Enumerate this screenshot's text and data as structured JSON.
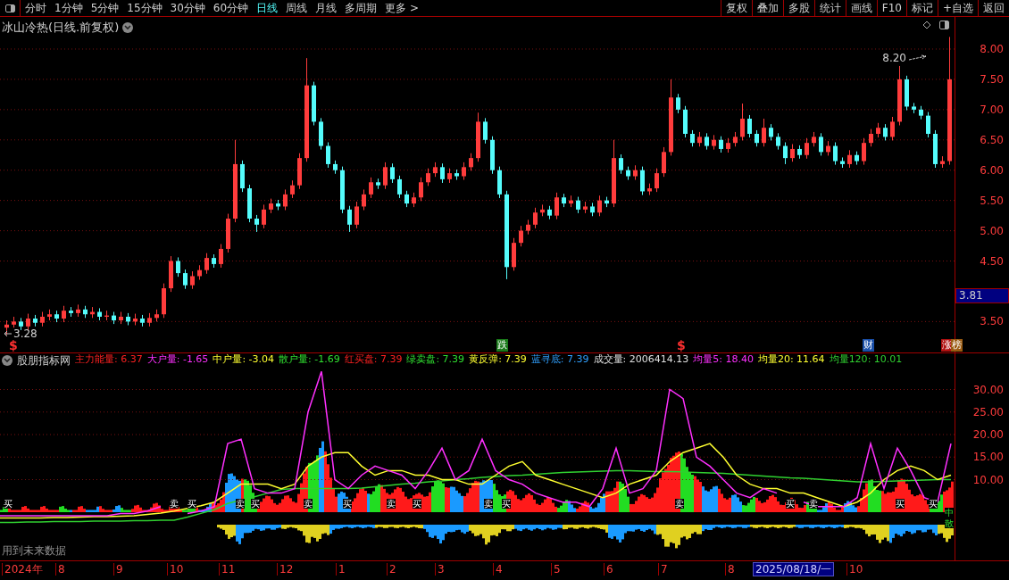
{
  "toolbar": {
    "periods": [
      {
        "label": "分时",
        "selected": false
      },
      {
        "label": "1分钟",
        "selected": false
      },
      {
        "label": "5分钟",
        "selected": false
      },
      {
        "label": "15分钟",
        "selected": false
      },
      {
        "label": "30分钟",
        "selected": false
      },
      {
        "label": "60分钟",
        "selected": false
      },
      {
        "label": "日线",
        "selected": true
      },
      {
        "label": "周线",
        "selected": false
      },
      {
        "label": "月线",
        "selected": false
      },
      {
        "label": "多周期",
        "selected": false
      },
      {
        "label": "更多 >",
        "selected": false
      }
    ],
    "buttons": [
      "复权",
      "叠加",
      "多股",
      "统计",
      "画线",
      "F10",
      "标记",
      "+自选",
      "返回"
    ]
  },
  "main_chart": {
    "title": "冰山冷热(日线.前复权)",
    "high_label": "8.20",
    "low_label": "3.28",
    "chart_data": {
      "type": "candlestick",
      "ylim": [
        2.99,
        8.53
      ],
      "grid": true,
      "yticks": [
        {
          "value": 8,
          "label": "8.00"
        },
        {
          "value": 7.5,
          "label": "7.50"
        },
        {
          "value": 7,
          "label": "7.00"
        },
        {
          "value": 6.5,
          "label": "6.50"
        },
        {
          "value": 6,
          "label": "6.00"
        },
        {
          "value": 5.5,
          "label": "5.50"
        },
        {
          "value": 5,
          "label": "5.00"
        },
        {
          "value": 4.5,
          "label": "4.50"
        },
        {
          "value": 3.5,
          "label": "3.50"
        }
      ],
      "ohlc": [
        [
          3.4,
          3.52,
          3.28,
          3.45
        ],
        [
          3.45,
          3.58,
          3.4,
          3.5
        ],
        [
          3.5,
          3.56,
          3.36,
          3.42
        ],
        [
          3.42,
          3.63,
          3.36,
          3.55
        ],
        [
          3.55,
          3.61,
          3.42,
          3.48
        ],
        [
          3.48,
          3.66,
          3.42,
          3.58
        ],
        [
          3.58,
          3.7,
          3.52,
          3.62
        ],
        [
          3.62,
          3.68,
          3.49,
          3.55
        ],
        [
          3.55,
          3.76,
          3.49,
          3.68
        ],
        [
          3.68,
          3.74,
          3.58,
          3.64
        ],
        [
          3.64,
          3.78,
          3.58,
          3.7
        ],
        [
          3.7,
          3.76,
          3.56,
          3.62
        ],
        [
          3.62,
          3.74,
          3.56,
          3.66
        ],
        [
          3.66,
          3.72,
          3.52,
          3.58
        ],
        [
          3.58,
          3.68,
          3.52,
          3.6
        ],
        [
          3.6,
          3.66,
          3.46,
          3.52
        ],
        [
          3.52,
          3.66,
          3.46,
          3.58
        ],
        [
          3.58,
          3.64,
          3.44,
          3.5
        ],
        [
          3.5,
          3.63,
          3.44,
          3.55
        ],
        [
          3.55,
          3.61,
          3.42,
          3.48
        ],
        [
          3.48,
          3.64,
          3.42,
          3.56
        ],
        [
          3.56,
          3.7,
          3.5,
          3.62
        ],
        [
          3.62,
          4.13,
          3.56,
          4.05
        ],
        [
          4.05,
          4.58,
          3.99,
          4.5
        ],
        [
          4.5,
          4.56,
          4.24,
          4.3
        ],
        [
          4.3,
          4.36,
          4.04,
          4.1
        ],
        [
          4.1,
          4.33,
          4.04,
          4.25
        ],
        [
          4.25,
          4.43,
          4.19,
          4.35
        ],
        [
          4.35,
          4.63,
          4.29,
          4.55
        ],
        [
          4.55,
          4.61,
          4.39,
          4.45
        ],
        [
          4.45,
          4.78,
          4.39,
          4.7
        ],
        [
          4.7,
          5.28,
          4.64,
          5.2
        ],
        [
          5.2,
          6.5,
          5.14,
          6.1
        ],
        [
          6.1,
          6.16,
          5.64,
          5.7
        ],
        [
          5.7,
          5.76,
          5.14,
          5.2
        ],
        [
          5.2,
          5.26,
          4.98,
          5.1
        ],
        [
          5.1,
          5.43,
          5.04,
          5.35
        ],
        [
          5.35,
          5.53,
          5.29,
          5.45
        ],
        [
          5.45,
          5.51,
          5.34,
          5.4
        ],
        [
          5.4,
          5.68,
          5.34,
          5.6
        ],
        [
          5.6,
          5.83,
          5.54,
          5.75
        ],
        [
          5.75,
          6.28,
          5.69,
          6.2
        ],
        [
          6.2,
          7.85,
          6.14,
          7.4
        ],
        [
          7.4,
          7.46,
          6.74,
          6.8
        ],
        [
          6.8,
          6.86,
          6.34,
          6.4
        ],
        [
          6.4,
          6.46,
          6.04,
          6.1
        ],
        [
          6.1,
          6.16,
          5.94,
          6.0
        ],
        [
          6.0,
          6.06,
          5.29,
          5.35
        ],
        [
          5.35,
          5.41,
          4.98,
          5.1
        ],
        [
          5.1,
          5.48,
          5.04,
          5.4
        ],
        [
          5.4,
          5.68,
          5.34,
          5.6
        ],
        [
          5.6,
          5.88,
          5.54,
          5.8
        ],
        [
          5.8,
          5.86,
          5.69,
          5.75
        ],
        [
          5.75,
          6.13,
          5.69,
          6.05
        ],
        [
          6.05,
          6.11,
          5.79,
          5.85
        ],
        [
          5.85,
          5.91,
          5.54,
          5.6
        ],
        [
          5.6,
          5.66,
          5.39,
          5.45
        ],
        [
          5.45,
          5.63,
          5.39,
          5.55
        ],
        [
          5.55,
          5.88,
          5.49,
          5.8
        ],
        [
          5.8,
          6.03,
          5.74,
          5.95
        ],
        [
          5.95,
          6.13,
          5.89,
          6.05
        ],
        [
          6.05,
          6.11,
          5.79,
          5.85
        ],
        [
          5.85,
          6.03,
          5.79,
          5.95
        ],
        [
          5.95,
          6.01,
          5.84,
          5.9
        ],
        [
          5.9,
          6.13,
          5.84,
          6.05
        ],
        [
          6.05,
          6.28,
          5.99,
          6.2
        ],
        [
          6.2,
          6.95,
          6.14,
          6.8
        ],
        [
          6.8,
          6.86,
          6.44,
          6.5
        ],
        [
          6.5,
          6.56,
          5.94,
          6.0
        ],
        [
          6.0,
          6.06,
          5.54,
          5.6
        ],
        [
          5.6,
          5.66,
          4.2,
          4.4
        ],
        [
          4.4,
          4.88,
          4.34,
          4.8
        ],
        [
          4.8,
          5.08,
          4.74,
          5.0
        ],
        [
          5.0,
          5.18,
          4.94,
          5.1
        ],
        [
          5.1,
          5.38,
          5.04,
          5.3
        ],
        [
          5.3,
          5.43,
          5.24,
          5.35
        ],
        [
          5.35,
          5.41,
          5.19,
          5.25
        ],
        [
          5.25,
          5.63,
          5.19,
          5.55
        ],
        [
          5.55,
          5.61,
          5.39,
          5.45
        ],
        [
          5.45,
          5.58,
          5.39,
          5.5
        ],
        [
          5.5,
          5.56,
          5.29,
          5.35
        ],
        [
          5.35,
          5.48,
          5.29,
          5.4
        ],
        [
          5.4,
          5.46,
          5.24,
          5.3
        ],
        [
          5.3,
          5.58,
          5.24,
          5.5
        ],
        [
          5.5,
          5.56,
          5.39,
          5.45
        ],
        [
          5.45,
          6.5,
          5.39,
          6.2
        ],
        [
          6.2,
          6.26,
          5.94,
          6.0
        ],
        [
          6.0,
          6.06,
          5.84,
          5.9
        ],
        [
          5.9,
          6.08,
          5.84,
          6.0
        ],
        [
          6.0,
          6.06,
          5.59,
          5.65
        ],
        [
          5.65,
          5.78,
          5.59,
          5.7
        ],
        [
          5.7,
          6.03,
          5.64,
          5.95
        ],
        [
          5.95,
          6.38,
          5.89,
          6.3
        ],
        [
          6.3,
          7.5,
          6.24,
          7.2
        ],
        [
          7.2,
          7.26,
          6.94,
          7.0
        ],
        [
          7.0,
          7.06,
          6.54,
          6.6
        ],
        [
          6.6,
          6.66,
          6.39,
          6.45
        ],
        [
          6.45,
          6.63,
          6.39,
          6.55
        ],
        [
          6.55,
          6.61,
          6.34,
          6.4
        ],
        [
          6.4,
          6.58,
          6.34,
          6.5
        ],
        [
          6.5,
          6.56,
          6.29,
          6.35
        ],
        [
          6.35,
          6.53,
          6.29,
          6.45
        ],
        [
          6.45,
          6.63,
          6.39,
          6.55
        ],
        [
          6.55,
          7.1,
          6.49,
          6.85
        ],
        [
          6.85,
          6.91,
          6.54,
          6.6
        ],
        [
          6.6,
          6.66,
          6.39,
          6.45
        ],
        [
          6.45,
          6.85,
          6.39,
          6.7
        ],
        [
          6.7,
          6.76,
          6.49,
          6.55
        ],
        [
          6.55,
          6.61,
          6.34,
          6.4
        ],
        [
          6.4,
          6.46,
          6.1,
          6.2
        ],
        [
          6.2,
          6.43,
          6.14,
          6.35
        ],
        [
          6.35,
          6.41,
          6.19,
          6.25
        ],
        [
          6.25,
          6.53,
          6.19,
          6.45
        ],
        [
          6.45,
          6.63,
          6.39,
          6.55
        ],
        [
          6.55,
          6.61,
          6.24,
          6.3
        ],
        [
          6.3,
          6.48,
          6.24,
          6.4
        ],
        [
          6.4,
          6.46,
          6.09,
          6.15
        ],
        [
          6.15,
          6.21,
          6.04,
          6.1
        ],
        [
          6.1,
          6.33,
          6.04,
          6.25
        ],
        [
          6.25,
          6.31,
          6.09,
          6.15
        ],
        [
          6.15,
          6.53,
          6.09,
          6.45
        ],
        [
          6.45,
          6.68,
          6.39,
          6.6
        ],
        [
          6.6,
          6.78,
          6.54,
          6.7
        ],
        [
          6.7,
          6.76,
          6.49,
          6.55
        ],
        [
          6.55,
          6.88,
          6.49,
          6.8
        ],
        [
          6.8,
          7.72,
          6.74,
          7.5
        ],
        [
          7.5,
          7.56,
          6.99,
          7.05
        ],
        [
          7.05,
          7.11,
          6.94,
          7.0
        ],
        [
          7.0,
          7.06,
          6.84,
          6.9
        ],
        [
          6.9,
          6.96,
          6.54,
          6.6
        ],
        [
          6.6,
          6.66,
          6.04,
          6.1
        ],
        [
          6.1,
          6.23,
          6.04,
          6.15
        ],
        [
          6.15,
          8.2,
          6.09,
          7.5
        ]
      ]
    },
    "current_price": "3.81",
    "markers": [
      {
        "text": "$",
        "kind": "text",
        "color": "#ff3030"
      },
      {
        "text": "跌",
        "kind": "tag",
        "color": "#1a7a1a"
      },
      {
        "text": "$",
        "kind": "text",
        "color": "#ff3030"
      },
      {
        "text": "财",
        "kind": "tag",
        "color": "#1a4fa8"
      },
      {
        "text": "涨",
        "kind": "tag",
        "color": "#b01010"
      },
      {
        "text": "榜",
        "kind": "tag",
        "color": "#9a5a10"
      }
    ]
  },
  "indicator": {
    "name": "股朋指标网",
    "values": [
      {
        "label": "主力能量: 6.37",
        "color": "#ff2020"
      },
      {
        "label": "大户量: -1.65",
        "color": "#ff30ff"
      },
      {
        "label": "中户量: -3.04",
        "color": "#ffff30"
      },
      {
        "label": "散户量: -1.69",
        "color": "#30e030"
      },
      {
        "label": "红买盘: 7.39",
        "color": "#ff2020"
      },
      {
        "label": "绿卖盘: 7.39",
        "color": "#30e030"
      },
      {
        "label": "黄反弹: 7.39",
        "color": "#ffff30"
      },
      {
        "label": "蓝寻底: 7.39",
        "color": "#30a0ff"
      },
      {
        "label": "成交量: 2006414.13",
        "color": "#e0e0e0"
      }
    ],
    "legend_readings": [
      ": 18.40",
      ": 11.64",
      ": 10.01"
    ],
    "chart_data": {
      "type": "line",
      "ylim": [
        -8.12,
        38.22
      ],
      "grid": true,
      "yticks": [
        {
          "value": 30,
          "label": "30.00"
        },
        {
          "value": 25,
          "label": "25.00"
        },
        {
          "value": 20,
          "label": "20.00"
        },
        {
          "value": 15,
          "label": "15.00"
        },
        {
          "value": 10,
          "label": "10.00"
        }
      ],
      "series": [
        {
          "name": "均量5",
          "color": "#ff30ff",
          "values": [
            2,
            2,
            2,
            2,
            2,
            2,
            2,
            2,
            2,
            2.5,
            2.5,
            3,
            4,
            null,
            2.5,
            3,
            4,
            18,
            19,
            8,
            7,
            7,
            8,
            25,
            34,
            10,
            8,
            11,
            13,
            12,
            11,
            8,
            12,
            17,
            10,
            12,
            19,
            12,
            10,
            9,
            7,
            6,
            5,
            5,
            4,
            8,
            17,
            7,
            8,
            12,
            30,
            28,
            15,
            13,
            10,
            7,
            6,
            8,
            7,
            null,
            5,
            4,
            4,
            4,
            6,
            18,
            8,
            17,
            12,
            6,
            5,
            18
          ]
        },
        {
          "name": "均量20",
          "color": "#ffff30",
          "values": [
            1.5,
            1.5,
            1.5,
            1.5,
            1.6,
            1.6,
            1.7,
            1.8,
            1.8,
            1.9,
            2,
            2.3,
            2.6,
            3,
            3.6,
            4.2,
            5,
            7,
            9,
            9,
            9,
            8,
            9,
            13,
            15,
            16,
            16,
            13,
            11,
            12,
            12,
            11,
            11,
            10,
            10,
            9,
            9,
            11,
            13,
            14,
            11,
            10,
            9,
            8,
            7,
            6,
            7,
            9,
            10,
            11,
            14,
            16,
            17,
            18,
            15,
            11,
            9,
            8,
            8,
            7,
            7,
            6,
            5,
            4,
            5,
            7,
            10,
            12,
            13,
            12,
            10,
            11
          ]
        },
        {
          "name": "均量120",
          "color": "#30d030",
          "values": [
            0.5,
            0.5,
            0.6,
            0.6,
            0.7,
            0.7,
            0.7,
            0.8,
            0.8,
            0.8,
            0.9,
            0.9,
            1,
            1,
            1.7,
            2.5,
            3.3,
            4.7,
            5.5,
            6.2,
            7,
            7.8,
            8,
            8,
            8,
            8,
            8,
            8.1,
            8.4,
            8.7,
            9,
            9.2,
            9.5,
            9.7,
            10,
            10.2,
            10.5,
            10.7,
            10.9,
            11,
            11.2,
            11.4,
            11.6,
            11.7,
            11.8,
            11.9,
            12,
            12,
            11.9,
            11.8,
            11.8,
            11.7,
            11.6,
            11.5,
            11.4,
            11.2,
            11,
            10.8,
            10.6,
            10.4,
            10.3,
            10.1,
            9.9,
            9.7,
            9.5,
            9.5,
            9.6,
            9.7,
            9.8,
            9.9,
            10,
            10
          ]
        }
      ]
    },
    "signals": [
      {
        "text": "买"
      },
      {
        "text": "卖"
      },
      {
        "text": "买"
      },
      {
        "text": "卖"
      },
      {
        "text": "买"
      },
      {
        "text": "卖"
      },
      {
        "text": "买"
      },
      {
        "text": "卖"
      },
      {
        "text": "买"
      },
      {
        "text": "卖"
      },
      {
        "text": "买"
      },
      {
        "text": "卖"
      },
      {
        "text": "买"
      },
      {
        "text": "卖"
      },
      {
        "text": "买"
      },
      {
        "text": "买"
      }
    ],
    "side_labels": [
      "中",
      "散"
    ],
    "note": "用到未来数据"
  },
  "date_axis": [
    {
      "label": "2024年",
      "kind": "plain"
    },
    {
      "label": "8",
      "kind": "plain"
    },
    {
      "label": "9",
      "kind": "plain"
    },
    {
      "label": "10",
      "kind": "plain"
    },
    {
      "label": "11",
      "kind": "plain"
    },
    {
      "label": "12",
      "kind": "plain"
    },
    {
      "label": "1",
      "kind": "plain"
    },
    {
      "label": "2",
      "kind": "plain"
    },
    {
      "label": "3",
      "kind": "plain"
    },
    {
      "label": "4",
      "kind": "plain"
    },
    {
      "label": "5",
      "kind": "plain"
    },
    {
      "label": "6",
      "kind": "plain"
    },
    {
      "label": "7",
      "kind": "plain"
    },
    {
      "label": "8",
      "kind": "plain"
    },
    {
      "label": "2025/08/18/一",
      "kind": "cursor"
    },
    {
      "label": "10",
      "kind": "plain"
    }
  ]
}
